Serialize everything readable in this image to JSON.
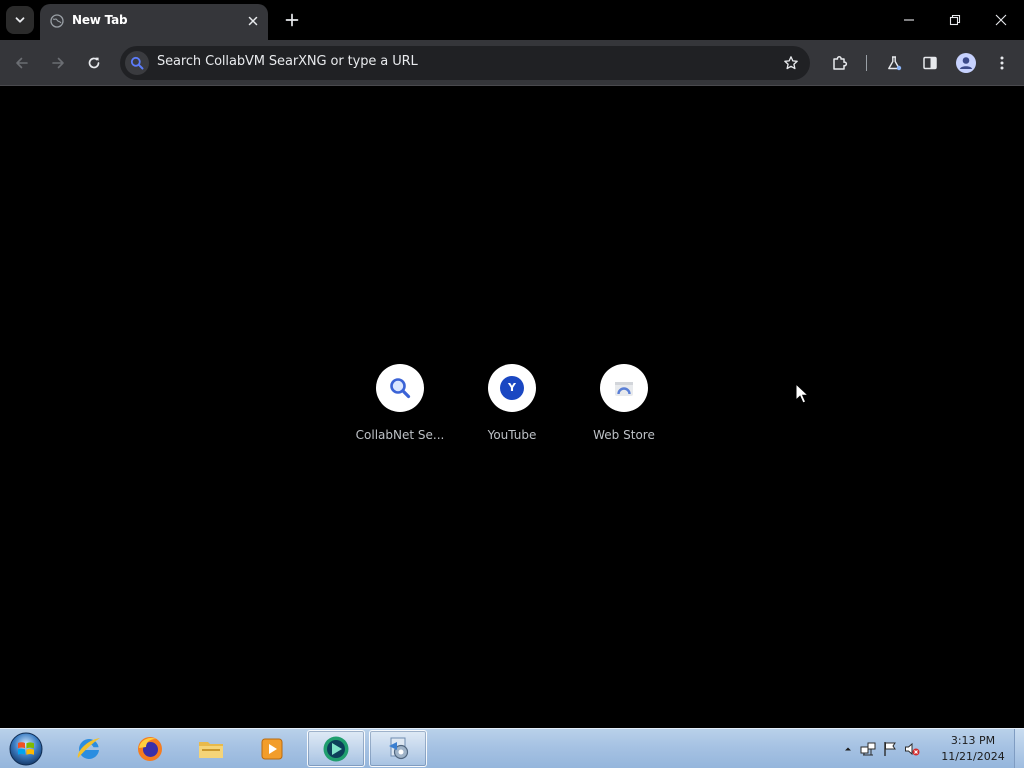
{
  "browser": {
    "tab": {
      "title": "New Tab",
      "close_icon": "close-icon",
      "favicon": "globe-icon"
    },
    "new_tab_icon": "plus-icon",
    "window_controls": [
      "minimize-icon",
      "restore-icon",
      "close-icon"
    ],
    "toolbar": {
      "back_icon": "arrow-left-icon",
      "forward_icon": "arrow-right-icon",
      "reload_icon": "reload-icon",
      "omnibox_placeholder": "Search CollabVM SearXNG or type a URL",
      "bookmark_icon": "star-icon",
      "right_icons": [
        "extensions-icon",
        "labs-flask-icon",
        "side-panel-icon",
        "profile-icon",
        "menu-kebab-icon"
      ]
    },
    "colors": {
      "tab_active": "#35363a",
      "toolbar": "#35363a",
      "omnibox": "#202124",
      "page_bg": "#000000",
      "shortcut_label": "#bdc1c6"
    }
  },
  "new_tab_page": {
    "shortcuts": [
      {
        "label": "CollabNet Se...",
        "icon": "magnifier-icon"
      },
      {
        "label": "YouTube",
        "icon": "letter-y-icon",
        "icon_letter": "Y"
      },
      {
        "label": "Web Store",
        "icon": "web-store-icon"
      }
    ]
  },
  "taskbar": {
    "apps": [
      {
        "name": "internet-explorer-icon",
        "open": false
      },
      {
        "name": "firefox-icon",
        "open": false
      },
      {
        "name": "file-explorer-icon",
        "open": false
      },
      {
        "name": "media-player-icon",
        "open": false
      },
      {
        "name": "chrome-like-browser-icon",
        "open": true
      },
      {
        "name": "control-panel-icon",
        "open": true
      }
    ],
    "tray_icons": [
      "show-hidden-icons-icon",
      "network-icon",
      "action-center-flag-icon",
      "volume-muted-icon"
    ],
    "clock": {
      "time": "3:13 PM",
      "date": "11/21/2024"
    }
  }
}
